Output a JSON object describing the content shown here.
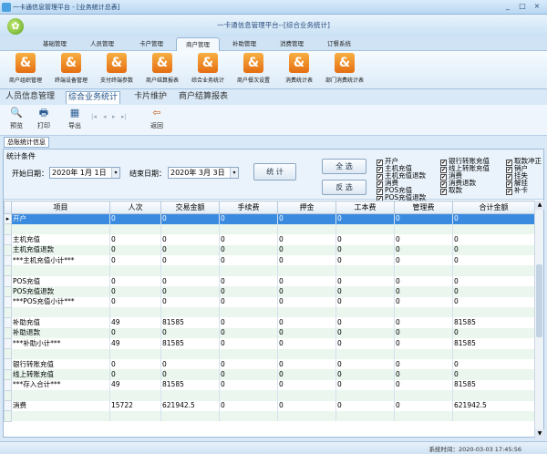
{
  "window": {
    "title": "一卡通信息管理平台 - [业务统计总表]",
    "min": "_",
    "max": "□",
    "close": "×"
  },
  "header": {
    "title": "一卡通信息管理平台--[综合业务统计]"
  },
  "nav_tabs": [
    "基础管理",
    "人员管理",
    "卡户管理",
    "商户管理",
    "补助管理",
    "消费管理",
    "订餐系统"
  ],
  "nav_active_index": 3,
  "ribbon": [
    "商户组织管理",
    "终端设备管理",
    "支付终端参数",
    "商户结算报表",
    "综合业务统计",
    "商户餐次设置",
    "消费统计表",
    "部门消费统计表"
  ],
  "main_tabs": [
    "人员信息管理",
    "综合业务统计",
    "卡片维护",
    "商户结算报表"
  ],
  "main_active_index": 1,
  "toolbar": {
    "preview": "预览",
    "print": "打印",
    "export": "导出",
    "back": "返回"
  },
  "subtab": "总账统计信息",
  "cond": {
    "title": "统计条件",
    "start_label": "开始日期：",
    "start_date": "2020年 1月 1日",
    "end_label": "结束日期：",
    "end_date": "2020年 3月 3日",
    "stat_button": "统 计",
    "select_all": "全 选",
    "invert": "反 选",
    "checks": [
      [
        "开户",
        "主机充值",
        "主机充值退款",
        "消费",
        "POS充值",
        "POS充值退款"
      ],
      [
        "银行转账充值",
        "线上转账充值",
        "消费",
        "消费退款",
        "取款"
      ],
      [
        "取款冲正",
        "销户",
        "挂失",
        "解挂",
        "补卡"
      ]
    ]
  },
  "table": {
    "columns": [
      "项目",
      "人次",
      "交易金额",
      "手续费",
      "押金",
      "工本费",
      "管理费",
      "合计金额"
    ],
    "rows": [
      [
        "开户",
        "0",
        "0",
        "0",
        "0",
        "0",
        "0",
        "0"
      ],
      [
        "",
        "",
        "",
        "",
        "",
        "",
        "",
        ""
      ],
      [
        "主机充值",
        "0",
        "0",
        "0",
        "0",
        "0",
        "0",
        "0"
      ],
      [
        "主机充值退款",
        "0",
        "0",
        "0",
        "0",
        "0",
        "0",
        "0"
      ],
      [
        "***主机充值小计***",
        "0",
        "0",
        "0",
        "0",
        "0",
        "0",
        "0"
      ],
      [
        "",
        "",
        "",
        "",
        "",
        "",
        "",
        ""
      ],
      [
        "POS充值",
        "0",
        "0",
        "0",
        "0",
        "0",
        "0",
        "0"
      ],
      [
        "POS充值退款",
        "0",
        "0",
        "0",
        "0",
        "0",
        "0",
        "0"
      ],
      [
        "***POS充值小计***",
        "0",
        "0",
        "0",
        "0",
        "0",
        "0",
        "0"
      ],
      [
        "",
        "",
        "",
        "",
        "",
        "",
        "",
        ""
      ],
      [
        "补助充值",
        "49",
        "81585",
        "0",
        "0",
        "0",
        "0",
        "81585"
      ],
      [
        "补助退款",
        "0",
        "0",
        "0",
        "0",
        "0",
        "0",
        "0"
      ],
      [
        "***补助小计***",
        "49",
        "81585",
        "0",
        "0",
        "0",
        "0",
        "81585"
      ],
      [
        "",
        "",
        "",
        "",
        "",
        "",
        "",
        ""
      ],
      [
        "银行转账充值",
        "0",
        "0",
        "0",
        "0",
        "0",
        "0",
        "0"
      ],
      [
        "线上转账充值",
        "0",
        "0",
        "0",
        "0",
        "0",
        "0",
        "0"
      ],
      [
        "***存入合计***",
        "49",
        "81585",
        "0",
        "0",
        "0",
        "0",
        "81585"
      ],
      [
        "",
        "",
        "",
        "",
        "",
        "",
        "",
        ""
      ],
      [
        "消费",
        "15722",
        "621942.5",
        "0",
        "0",
        "0",
        "0",
        "621942.5"
      ],
      [
        "",
        "",
        "",
        "",
        "",
        "",
        "",
        ""
      ]
    ]
  },
  "status": {
    "time": "系统时间：2020-03-03 17:45:56"
  }
}
